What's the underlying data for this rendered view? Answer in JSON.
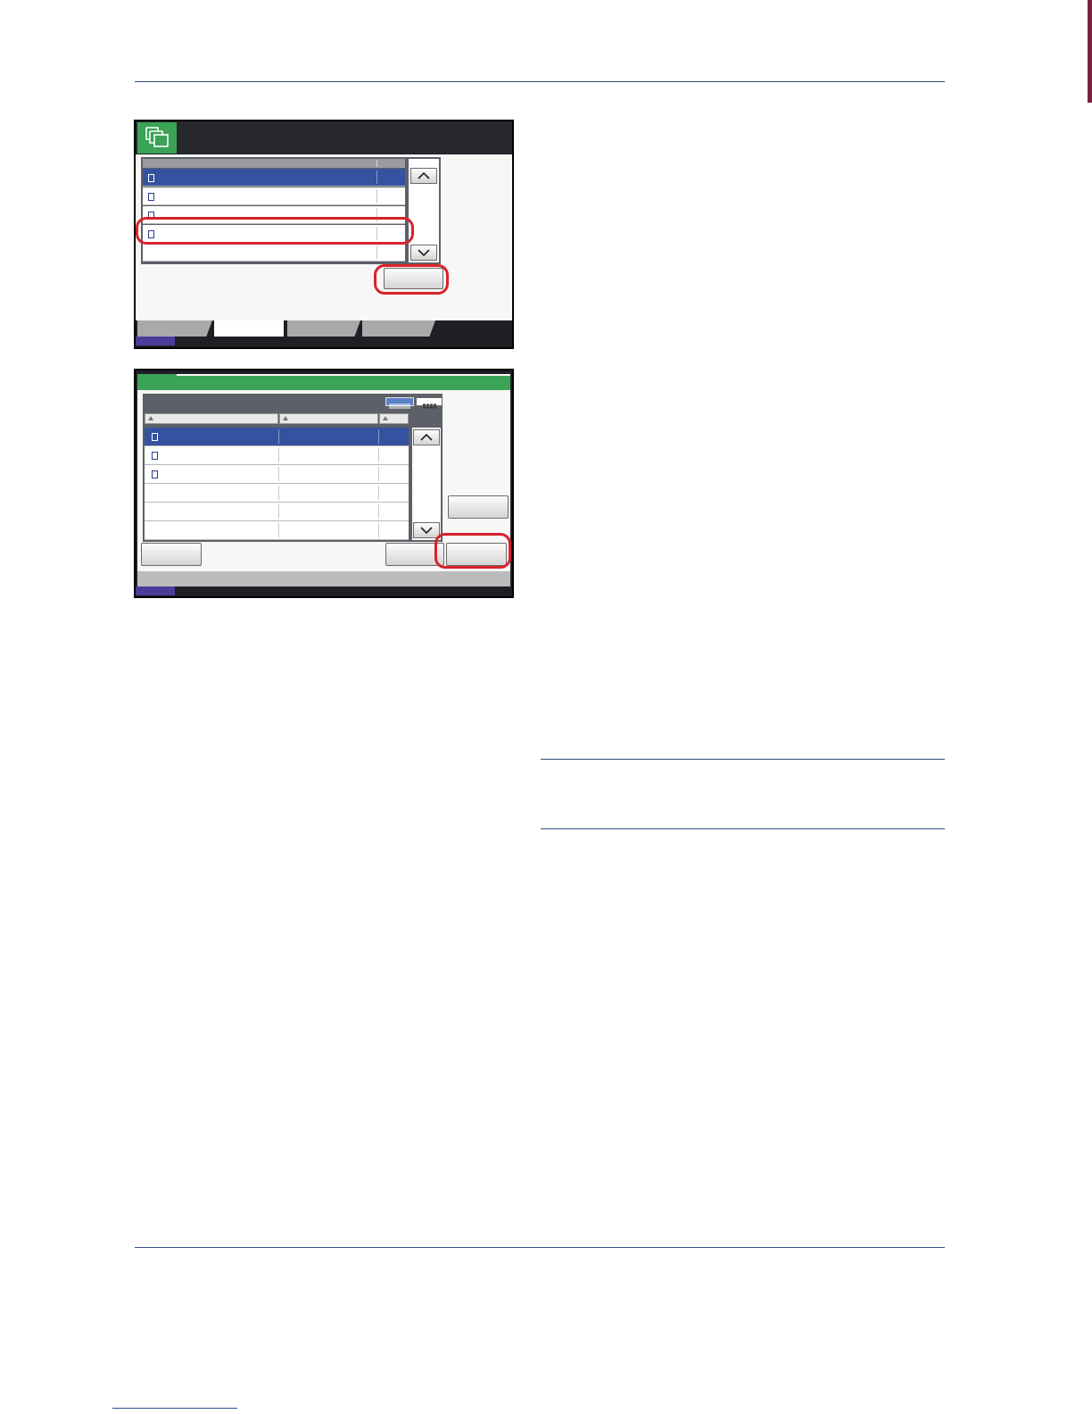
{
  "page": {
    "accent_color": "#7a2141",
    "rule_color": "#2e4f80",
    "highlight_color": "#d9222a"
  },
  "screen1": {
    "app_icon": "document-box-icon",
    "rows": [
      {
        "selected": true
      },
      {
        "selected": false
      },
      {
        "selected": false
      },
      {
        "selected": false,
        "highlighted": true
      },
      {
        "selected": false,
        "empty": true
      }
    ],
    "tabs": [
      {
        "active": false
      },
      {
        "active": true
      },
      {
        "active": false
      },
      {
        "active": false
      }
    ]
  },
  "screen2": {
    "rows": [
      {
        "selected": true,
        "icon": true
      },
      {
        "selected": false,
        "icon": true
      },
      {
        "selected": false,
        "icon": true
      },
      {
        "selected": false,
        "icon": false
      },
      {
        "selected": false,
        "icon": false
      },
      {
        "selected": false,
        "icon": false
      }
    ],
    "footer_icon": "enter-icon"
  }
}
